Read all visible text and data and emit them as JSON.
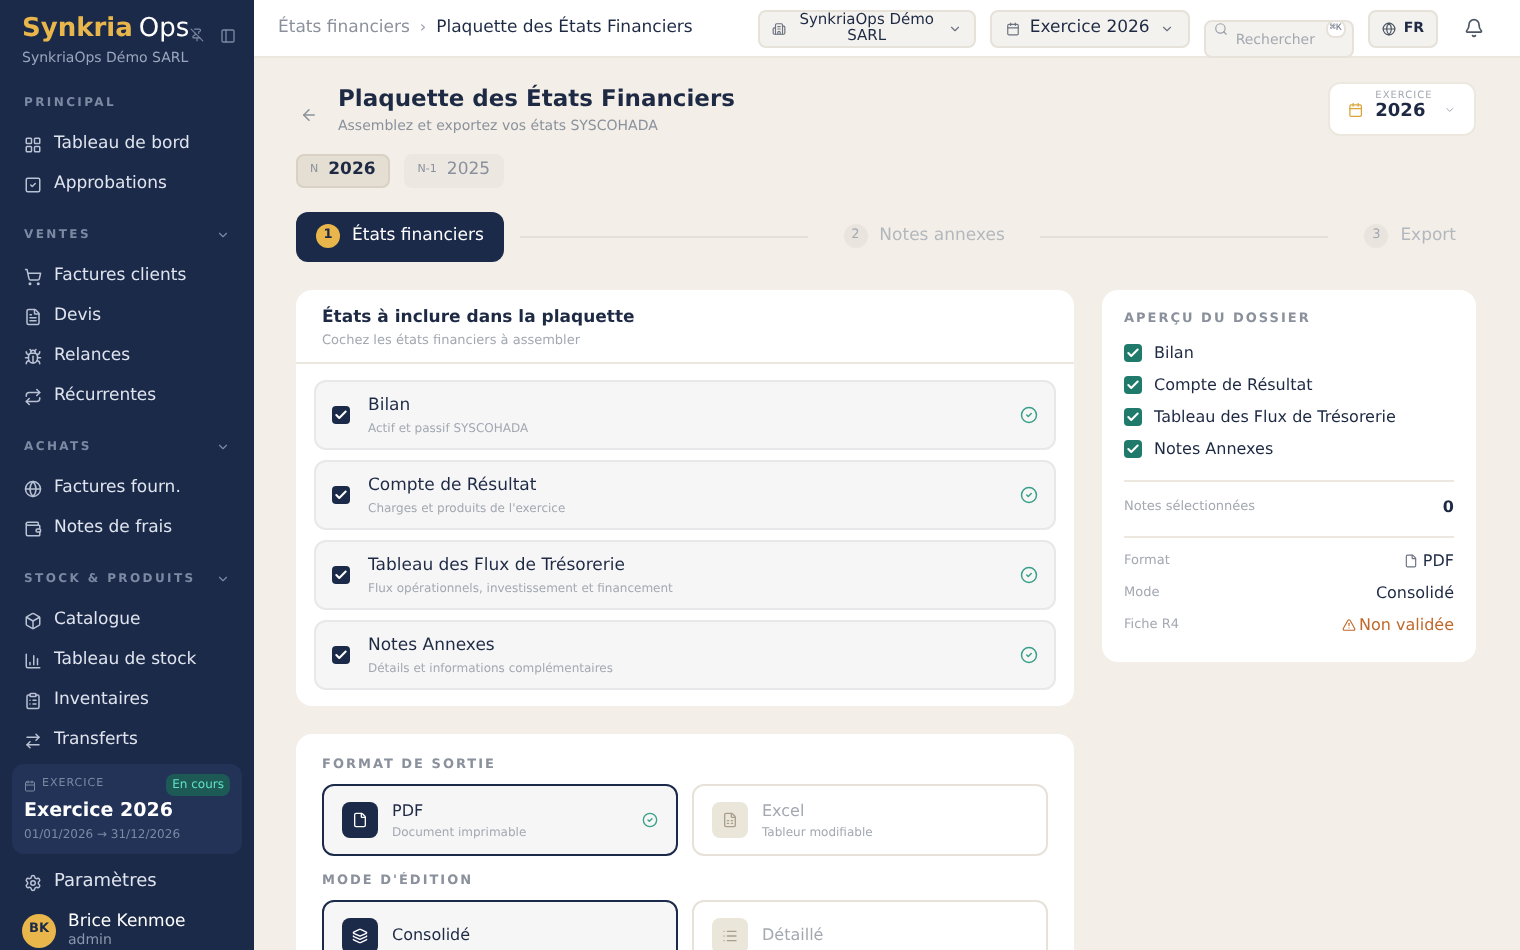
{
  "sidebar": {
    "brand": {
      "name": "Synkria",
      "suffix": "Ops",
      "company": "SynkriaOps Démo SARL"
    },
    "sections": [
      {
        "label": "PRINCIPAL",
        "kind": "fixed",
        "items": [
          {
            "label": "Tableau de bord"
          },
          {
            "label": "Approbations"
          }
        ]
      },
      {
        "label": "VENTES",
        "kind": "collapsible",
        "items": [
          {
            "label": "Factures clients"
          },
          {
            "label": "Devis"
          },
          {
            "label": "Relances"
          },
          {
            "label": "Récurrentes"
          }
        ]
      },
      {
        "label": "ACHATS",
        "kind": "collapsible",
        "items": [
          {
            "label": "Factures fourn."
          },
          {
            "label": "Notes de frais"
          }
        ]
      },
      {
        "label": "STOCK & PRODUITS",
        "kind": "collapsible",
        "items": [
          {
            "label": "Catalogue"
          },
          {
            "label": "Tableau de stock"
          },
          {
            "label": "Inventaires"
          },
          {
            "label": "Transferts"
          }
        ]
      }
    ],
    "exercise": {
      "label": "EXERCICE",
      "badge": "En cours",
      "title": "Exercice 2026",
      "range": "01/01/2026 → 31/12/2026"
    },
    "settings": "Paramètres",
    "user": {
      "initials": "BK",
      "name": "Brice Kenmoe",
      "role": "admin"
    }
  },
  "topbar": {
    "breadcrumb": {
      "items": [
        "États financiers",
        "Plaquette des États Financiers"
      ],
      "separator": "›"
    },
    "company": "SynkriaOps Démo SARL",
    "exercise": "Exercice 2026",
    "search": {
      "placeholder": "Rechercher",
      "shortcut": "⌘K"
    },
    "language": "FR"
  },
  "header": {
    "title": "Plaquette des États Financiers",
    "subtitle": "Assemblez et exportez vos états SYSCOHADA",
    "exercise_label": "EXERCICE",
    "exercise_value": "2026"
  },
  "years": [
    {
      "tag": "N",
      "value": "2026",
      "selected": true
    },
    {
      "tag": "N-1",
      "value": "2025",
      "selected": false
    }
  ],
  "steps": [
    {
      "number": "1",
      "label": "États financiers",
      "selected": true
    },
    {
      "number": "2",
      "label": "Notes annexes",
      "selected": false
    },
    {
      "number": "3",
      "label": "Export",
      "selected": false
    }
  ],
  "statements": {
    "title": "États à inclure dans la plaquette",
    "subtitle": "Cochez les états financiers à assembler",
    "items": [
      {
        "name": "Bilan",
        "description": "Actif et passif SYSCOHADA",
        "checked": true
      },
      {
        "name": "Compte de Résultat",
        "description": "Charges et produits de l'exercice",
        "checked": true
      },
      {
        "name": "Tableau des Flux de Trésorerie",
        "description": "Flux opérationnels, investissement et financement",
        "checked": true
      },
      {
        "name": "Notes Annexes",
        "description": "Détails et informations complémentaires",
        "checked": true
      }
    ]
  },
  "preview": {
    "title": "APERÇU DU DOSSIER",
    "items": [
      {
        "label": "Bilan",
        "checked": true
      },
      {
        "label": "Compte de Résultat",
        "checked": true
      },
      {
        "label": "Tableau des Flux de Trésorerie",
        "checked": true
      },
      {
        "label": "Notes Annexes",
        "checked": true
      }
    ],
    "notes_label": "Notes sélectionnées",
    "notes_value": "0",
    "details": [
      {
        "label": "Format",
        "value": "PDF",
        "kind": "file"
      },
      {
        "label": "Mode",
        "value": "Consolidé",
        "kind": "plain"
      },
      {
        "label": "Fiche R4",
        "value": "Non validée",
        "kind": "warning"
      }
    ]
  },
  "output": {
    "format_label": "FORMAT DE SORTIE",
    "formats": [
      {
        "name": "PDF",
        "description": "Document imprimable",
        "selected": true
      },
      {
        "name": "Excel",
        "description": "Tableur modifiable",
        "selected": false
      }
    ],
    "mode_label": "MODE D'ÉDITION",
    "modes": [
      {
        "name": "Consolidé",
        "selected": true
      },
      {
        "name": "Détaillé",
        "selected": false
      }
    ]
  }
}
